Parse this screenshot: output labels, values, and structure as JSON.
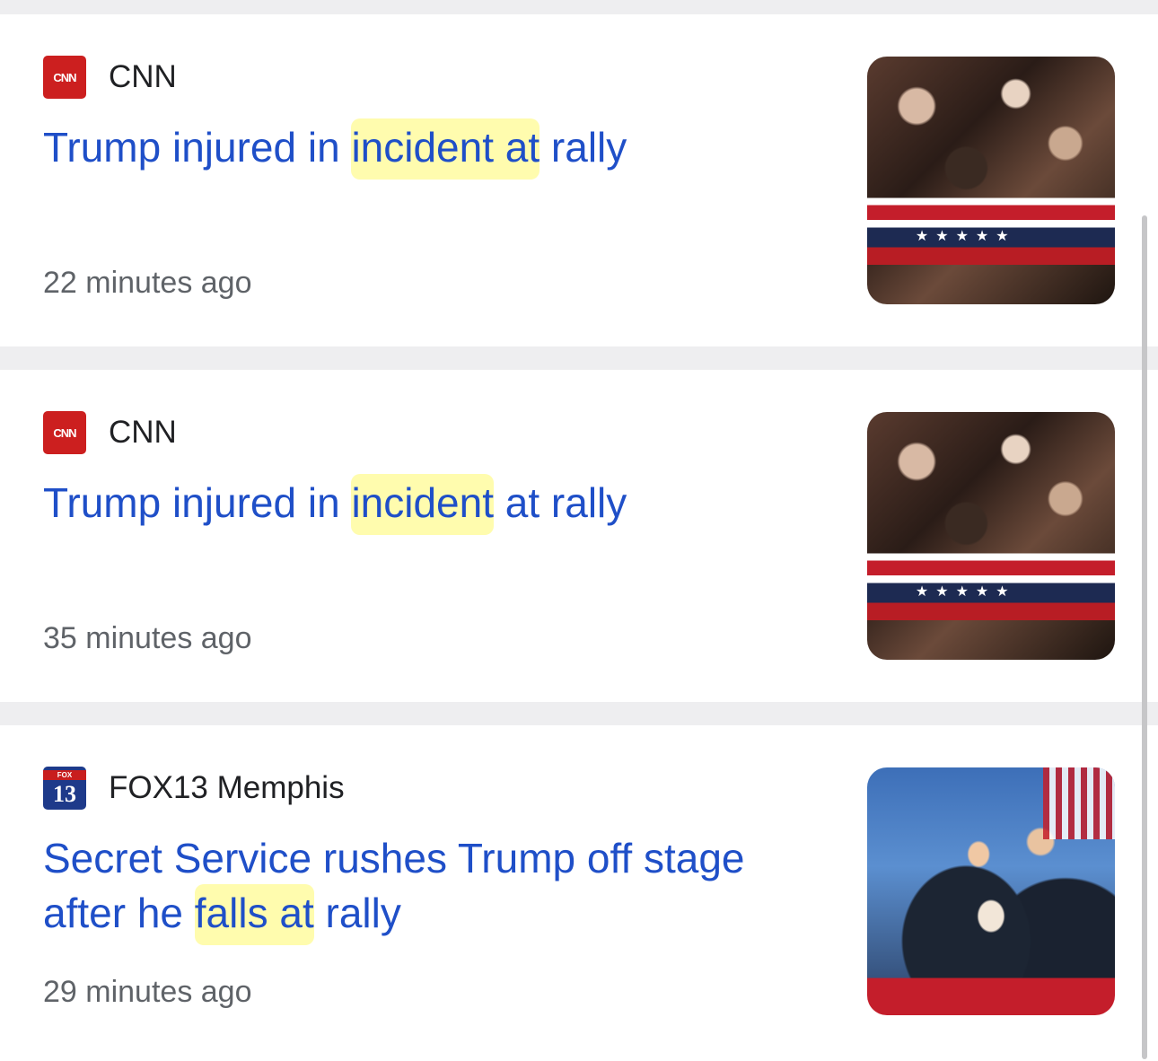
{
  "articles": [
    {
      "source": "CNN",
      "logo_text": "CNN",
      "headline_before": "Trump injured in ",
      "headline_highlight": "incident at",
      "headline_after": " rally",
      "time": "22 minutes ago"
    },
    {
      "source": "CNN",
      "logo_text": "CNN",
      "headline_before": "Trump injured in ",
      "headline_highlight": "incident",
      "headline_after": " at rally",
      "time": "35 minutes ago"
    },
    {
      "source": "FOX13 Memphis",
      "logo_top": "FOX",
      "logo_num": "13",
      "headline_before": "Secret Service rushes Trump off stage after he ",
      "headline_highlight": "falls at",
      "headline_after": " rally",
      "time": "29 minutes ago"
    }
  ],
  "colors": {
    "headline": "#1f4fc8",
    "highlight": "#fff878",
    "cnn_red": "#cc1f1f",
    "fox_blue": "#1e3a8a"
  }
}
